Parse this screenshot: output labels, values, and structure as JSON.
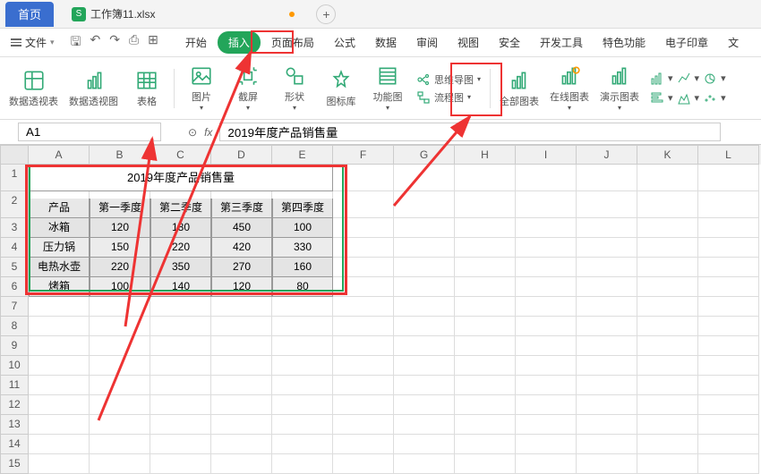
{
  "title_tab_home": "首页",
  "file_name": "工作簿11.xlsx",
  "file_badge": "S",
  "plus": "+",
  "menu_file": "文件",
  "menus": [
    "开始",
    "插入",
    "页面布局",
    "公式",
    "数据",
    "审阅",
    "视图",
    "安全",
    "开发工具",
    "特色功能",
    "电子印章",
    "文"
  ],
  "active_menu_index": 1,
  "ribbon": {
    "pivot_table": "数据透视表",
    "pivot_chart": "数据透视图",
    "table": "表格",
    "picture": "图片",
    "screenshot": "截屏",
    "shape": "形状",
    "icon_lib": "图标库",
    "function_chart": "功能图",
    "mind_map": "思维导图",
    "flow_chart": "流程图",
    "all_charts": "全部图表",
    "online_chart": "在线图表",
    "demo_chart": "演示图表"
  },
  "namebox": "A1",
  "fx_label": "fx",
  "formula_value": "2019年度产品销售量",
  "columns": [
    "A",
    "B",
    "C",
    "D",
    "E",
    "F",
    "G",
    "H",
    "I",
    "J",
    "K",
    "L"
  ],
  "row_count": 15,
  "chart_data": {
    "type": "table",
    "title": "2019年度产品销售量",
    "headers": [
      "产品",
      "第一季度",
      "第二季度",
      "第三季度",
      "第四季度"
    ],
    "rows": [
      [
        "冰箱",
        120,
        180,
        450,
        100
      ],
      [
        "压力锅",
        150,
        220,
        420,
        330
      ],
      [
        "电热水壶",
        220,
        350,
        270,
        160
      ],
      [
        "烤箱",
        100,
        140,
        120,
        80
      ]
    ]
  }
}
